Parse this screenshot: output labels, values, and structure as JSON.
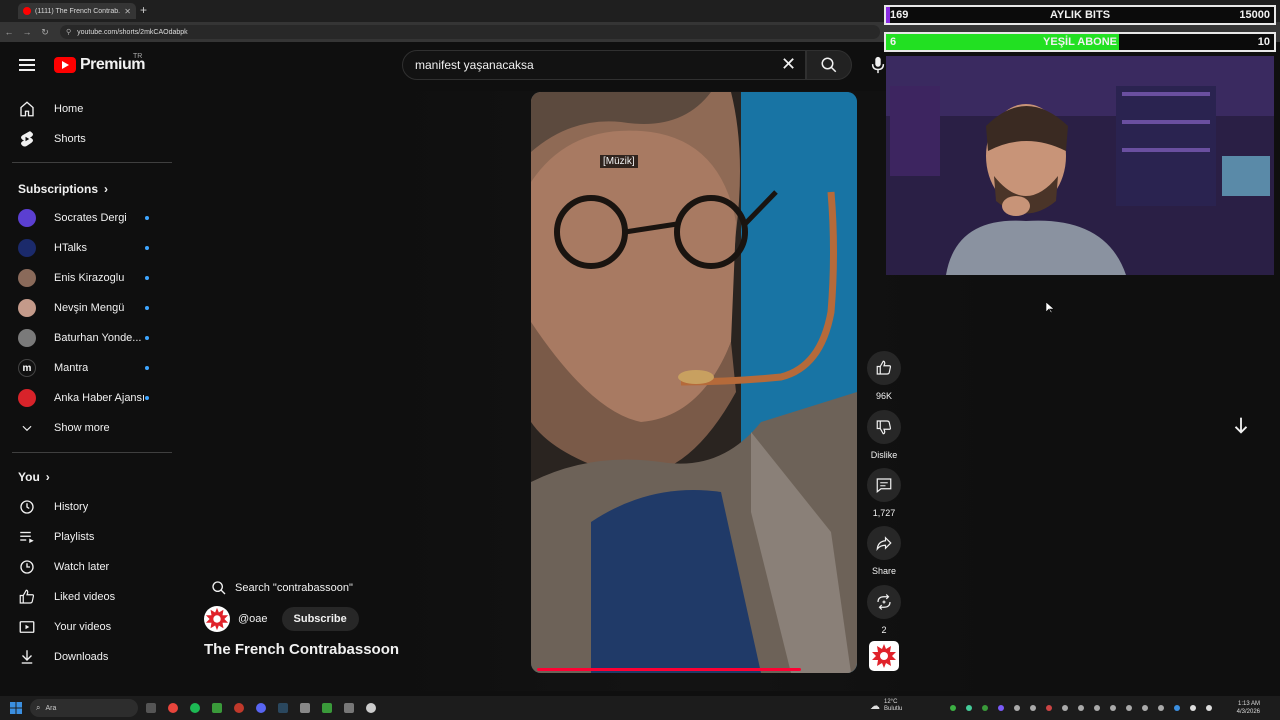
{
  "browser": {
    "tab_title": "(1111) The French Contrab...",
    "url": "youtube.com/shorts/2mkCAOdabpk"
  },
  "header": {
    "logo_text": "Premium",
    "country": "TR",
    "search_value": "manifest yaşanacaksa"
  },
  "sidebar": {
    "main": [
      {
        "label": "Home",
        "icon": "home-icon"
      },
      {
        "label": "Shorts",
        "icon": "shorts-icon"
      }
    ],
    "subscriptions_title": "Subscriptions",
    "subscriptions": [
      {
        "label": "Socrates Dergi",
        "color": "#5b3fd1"
      },
      {
        "label": "HTalks",
        "color": "#1b2a6b"
      },
      {
        "label": "Enis Kirazoglu",
        "color": "#8a6a5a"
      },
      {
        "label": "Nevşin Mengü",
        "color": "#c49a8a"
      },
      {
        "label": "Baturhan Yonde...",
        "color": "#7a7a7a"
      },
      {
        "label": "Mantra",
        "color": "#111111"
      },
      {
        "label": "Anka Haber Ajansı",
        "color": "#d8232a"
      }
    ],
    "show_more": "Show more",
    "you_title": "You",
    "you_items": [
      {
        "label": "History",
        "icon": "history-icon"
      },
      {
        "label": "Playlists",
        "icon": "playlists-icon"
      },
      {
        "label": "Watch later",
        "icon": "watch-later-icon"
      },
      {
        "label": "Liked videos",
        "icon": "liked-videos-icon"
      },
      {
        "label": "Your videos",
        "icon": "your-videos-icon"
      },
      {
        "label": "Downloads",
        "icon": "downloads-icon"
      }
    ]
  },
  "short": {
    "caption": "[Müzik]",
    "search_suggest": "Search \"contrabassoon\"",
    "channel": "@oae",
    "subscribe": "Subscribe",
    "title": "The French Contrabassoon",
    "progress": 0.84,
    "actions": {
      "likes": "96K",
      "dislike": "Dislike",
      "comments": "1,727",
      "share": "Share",
      "remix": "2"
    }
  },
  "overlay": {
    "bits": {
      "left": "169",
      "label": "AYLIK BITS",
      "right": "15000",
      "fill_color": "#8a2be2",
      "progress": 0.011
    },
    "subs": {
      "left": "6",
      "label": "YEŞİL ABONE",
      "right": "10",
      "fill_color": "#22e022",
      "progress": 0.6
    }
  },
  "taskbar": {
    "search": "Ara",
    "weather_temp": "12°C",
    "weather_desc": "Bulutlu",
    "time": "1:13 AM",
    "date": "4/3/2026"
  }
}
